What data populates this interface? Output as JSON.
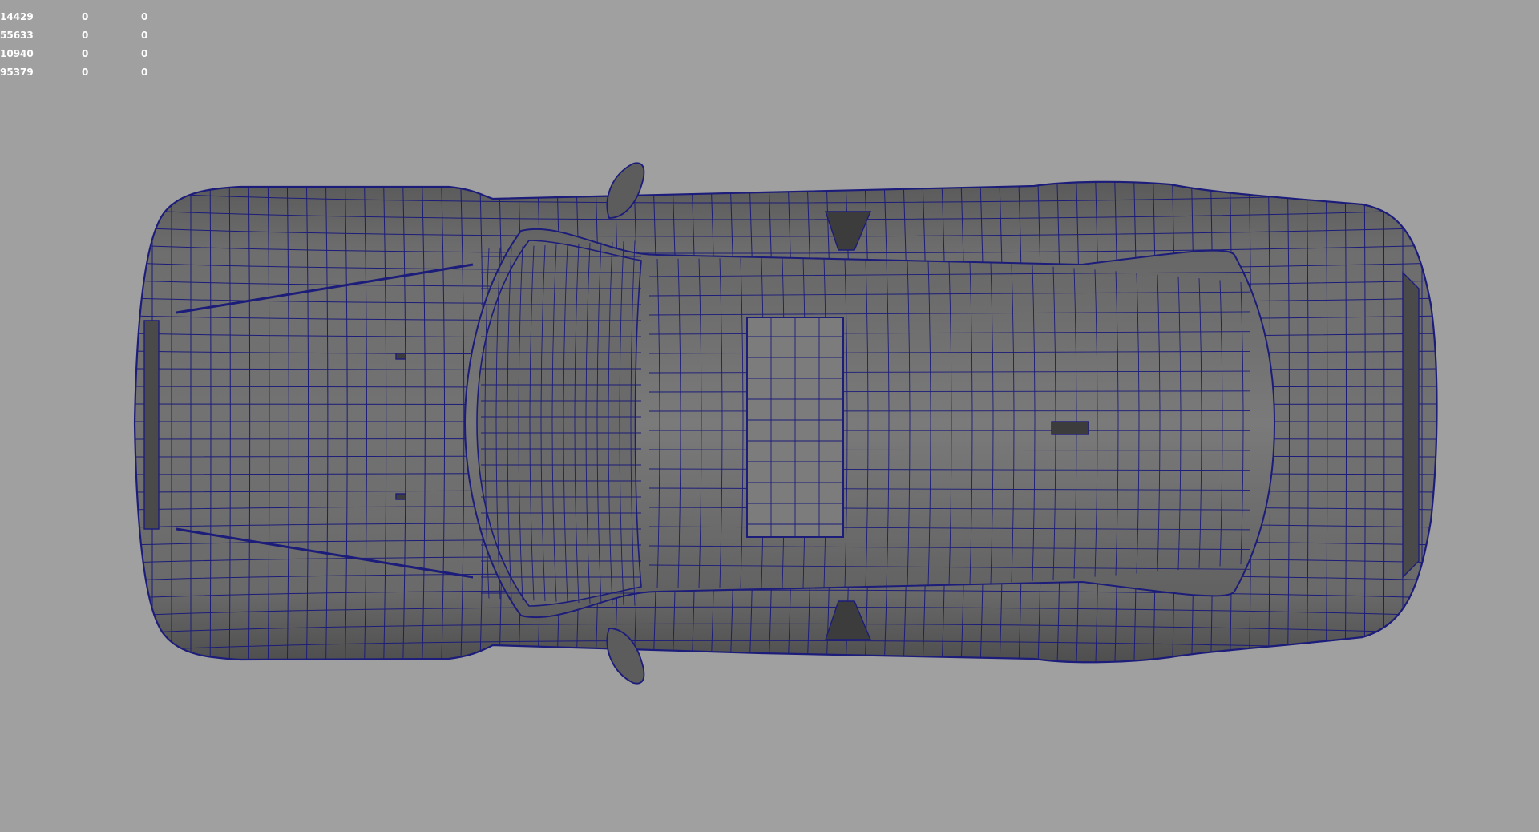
{
  "hud": {
    "rows": [
      {
        "label": "14429",
        "v1": "0",
        "v2": "0"
      },
      {
        "label": "55633",
        "v1": "0",
        "v2": "0"
      },
      {
        "label": "10940",
        "v1": "0",
        "v2": "0"
      },
      {
        "label": "95379",
        "v1": "0",
        "v2": "0"
      }
    ]
  },
  "colors": {
    "background": "#a0a0a0",
    "wireframe": "#1c1c7a",
    "shaded": "#6e6e6e",
    "shaded_dark": "#4a4a4a",
    "hud_text": "#ffffff"
  },
  "model": {
    "icon": "car-wireframe-top-view"
  }
}
